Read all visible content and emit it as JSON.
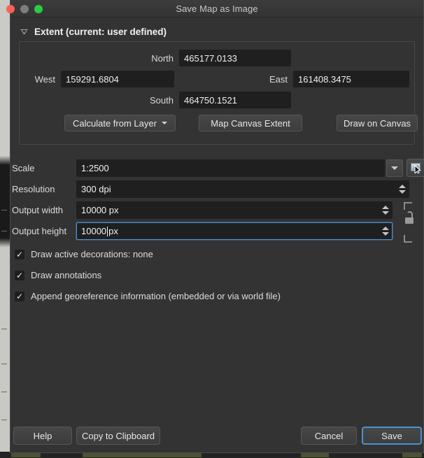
{
  "window": {
    "title": "Save Map as Image",
    "traffic_lights": [
      "close-button",
      "minimize-button",
      "zoom-button"
    ]
  },
  "extent": {
    "group_title": "Extent (current: user defined)",
    "collapse_icon": "chevron-down-icon",
    "north": {
      "label": "North",
      "value": "465177.0133"
    },
    "west": {
      "label": "West",
      "value": "159291.6804"
    },
    "east": {
      "label": "East",
      "value": "161408.3475"
    },
    "south": {
      "label": "South",
      "value": "464750.1521"
    },
    "buttons": {
      "calculate_from_layer": "Calculate from Layer",
      "map_canvas_extent": "Map Canvas Extent",
      "draw_on_canvas": "Draw on Canvas"
    }
  },
  "settings": {
    "scale": {
      "label": "Scale",
      "value": "1:2500",
      "dropdown_icon": "chevron-down-icon",
      "pick_icon": "set-scale-from-canvas-icon"
    },
    "resolution": {
      "label": "Resolution",
      "value": "300 dpi",
      "spinner_icon": "spinner-arrows-icon"
    },
    "output_width": {
      "label": "Output width",
      "value": "10000 px",
      "spinner_icon": "spinner-arrows-icon"
    },
    "output_height": {
      "label": "Output height",
      "value_number": "10000",
      "value_suffix": " px",
      "focused": true,
      "spinner_icon": "spinner-arrows-icon"
    },
    "aspect_lock": {
      "icon": "unlocked-padlock-icon",
      "locked": false
    }
  },
  "checkboxes": [
    {
      "label": "Draw active decorations: none",
      "checked": true,
      "mark": "✓"
    },
    {
      "label": "Draw annotations",
      "checked": true,
      "mark": "✓"
    },
    {
      "label": "Append georeference information (embedded or via world file)",
      "checked": true,
      "mark": "✓"
    }
  ],
  "footer": {
    "help": "Help",
    "copy_to_clipboard": "Copy to Clipboard",
    "cancel": "Cancel",
    "save": "Save"
  },
  "colors": {
    "dialog_bg": "#333333",
    "field_bg": "#1f1f1f",
    "focus_blue": "#4a90d9",
    "text": "#dcdcdc",
    "close_red": "#ff5f57",
    "minimize_gray": "#7d7d7d",
    "zoom_green": "#2bcc3e"
  }
}
